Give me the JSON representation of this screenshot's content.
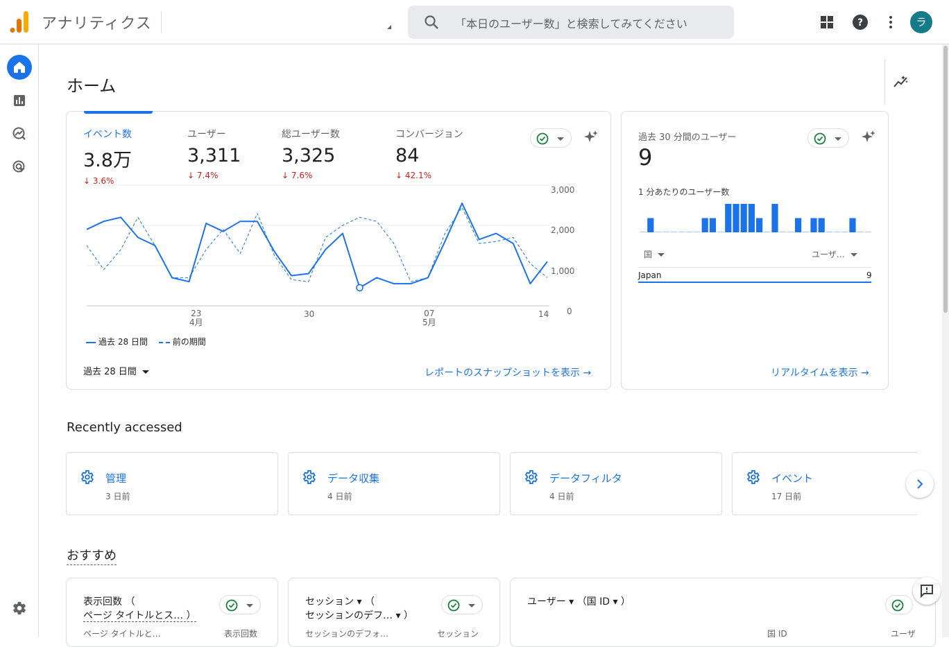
{
  "app": {
    "title": "アナリティクス",
    "avatar_letter": "ラ"
  },
  "search": {
    "placeholder": "「本日のユーザー数」と検索してみてください"
  },
  "icons": {
    "apps": "apps-grid-icon",
    "help": "help-icon",
    "more": "more-vert-icon"
  },
  "colors": {
    "accent": "#1a73e8",
    "negative": "#c5221f",
    "avatar": "#137c88"
  },
  "page": {
    "title": "ホーム"
  },
  "summary": {
    "metrics": [
      {
        "label": "イベント数",
        "value": "3.8万",
        "delta": "3.6%"
      },
      {
        "label": "ユーザー",
        "value": "3,311",
        "delta": "7.4%"
      },
      {
        "label": "総ユーザー数",
        "value": "3,325",
        "delta": "7.6%"
      },
      {
        "label": "コンバージョン",
        "value": "84",
        "delta": "42.1%"
      }
    ],
    "y_ticks": [
      "3,000",
      "2,000",
      "1,000",
      "0"
    ],
    "x_ticks": [
      {
        "day": "23",
        "month": "4月"
      },
      {
        "day": "30",
        "month": ""
      },
      {
        "day": "07",
        "month": "5月"
      },
      {
        "day": "14",
        "month": ""
      }
    ],
    "legend_current": "過去 28 日間",
    "legend_previous": "前の期間",
    "range_label": "過去 28 日間",
    "snapshot_link": "レポートのスナップショットを表示"
  },
  "chart_data": {
    "type": "line",
    "ylim": [
      0,
      3000
    ],
    "x": [
      "4/17",
      "4/18",
      "4/19",
      "4/20",
      "4/21",
      "4/22",
      "4/23",
      "4/24",
      "4/25",
      "4/26",
      "4/27",
      "4/28",
      "4/29",
      "4/30",
      "5/1",
      "5/2",
      "5/3",
      "5/4",
      "5/5",
      "5/6",
      "5/7",
      "5/8",
      "5/9",
      "5/10",
      "5/11",
      "5/12",
      "5/13",
      "5/14"
    ],
    "series": [
      {
        "name": "過去 28 日間",
        "values": [
          1900,
          2100,
          2200,
          1700,
          1500,
          700,
          600,
          2050,
          1850,
          2100,
          2100,
          1350,
          750,
          800,
          1400,
          1800,
          450,
          700,
          550,
          550,
          700,
          1600,
          2550,
          1650,
          1800,
          1550,
          550,
          1100
        ]
      },
      {
        "name": "前の期間",
        "values": [
          1500,
          900,
          1400,
          2200,
          1500,
          700,
          700,
          1400,
          1900,
          1300,
          2300,
          1250,
          650,
          600,
          1700,
          2000,
          2200,
          2100,
          1550,
          600,
          700,
          1800,
          2450,
          1550,
          1600,
          1700,
          1050,
          700
        ]
      }
    ]
  },
  "realtime": {
    "label": "過去 30 分間のユーザー",
    "value": "9",
    "bar_label": "1 分あたりのユーザー数",
    "bars": [
      0,
      1,
      0,
      0,
      0,
      0,
      0,
      0,
      1,
      1,
      0,
      2,
      2,
      2,
      2,
      1,
      0,
      2,
      0,
      0,
      1,
      0,
      1,
      1,
      0,
      0,
      0,
      1,
      0,
      0
    ],
    "col_country": "国",
    "col_users": "ユーザ…",
    "rows": [
      {
        "country": "Japan",
        "users": "9"
      }
    ],
    "link": "リアルタイムを表示"
  },
  "recent": {
    "title": "Recently accessed",
    "items": [
      {
        "name": "管理",
        "time": "3 日前"
      },
      {
        "name": "データ収集",
        "time": "4 日前"
      },
      {
        "name": "データフィルタ",
        "time": "4 日前"
      },
      {
        "name": "イベント",
        "time": "17 日前"
      }
    ]
  },
  "recommend": {
    "title": "おすすめ",
    "cards": [
      {
        "title_l1": "表示回数 （",
        "title_l2": "ページ タイトルとス… ）",
        "col1": "ページ タイトルと…",
        "col2": "表示回数"
      },
      {
        "title_l1": "セッション ▾ （",
        "title_l2": "セッションのデフ… ▾ ）",
        "col1": "セッションのデフォ…",
        "col2": "セッション"
      },
      {
        "title_l1": "ユーザー ▾ （国 ID ▾ ）",
        "col1": "国 ID",
        "col2": "ユーザ"
      }
    ]
  }
}
